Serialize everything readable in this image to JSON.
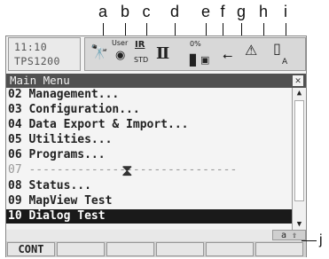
{
  "callouts": [
    "a",
    "b",
    "c",
    "d",
    "e",
    "f",
    "g",
    "h",
    "i"
  ],
  "callout_j": "j",
  "status": {
    "time": "11:10",
    "instrument": "TPS1200",
    "icons": [
      {
        "name": "binoculars-icon"
      },
      {
        "name": "user-icon",
        "label": "User"
      },
      {
        "name": "ir-icon",
        "label": "IR",
        "sublabel": "STD"
      },
      {
        "name": "prism-icon"
      },
      {
        "name": "battery-icon",
        "label": "0%"
      },
      {
        "name": "sd-card-icon"
      },
      {
        "name": "level-icon"
      },
      {
        "name": "warning-icon"
      },
      {
        "name": "memory-icon",
        "label": "A"
      }
    ]
  },
  "menu": {
    "title": "Main Menu",
    "items": [
      "02 Management...",
      "03 Configuration...",
      "04 Data Export & Import...",
      "05 Utilities...",
      "06 Programs...",
      "07 ------------------------------",
      "08 Status...",
      "09 MapView Test",
      "10 Dialog Test"
    ],
    "selected_index": 8
  },
  "input_mode": "a ⇧",
  "softkeys": [
    "CONT",
    "",
    "",
    "",
    "",
    ""
  ]
}
